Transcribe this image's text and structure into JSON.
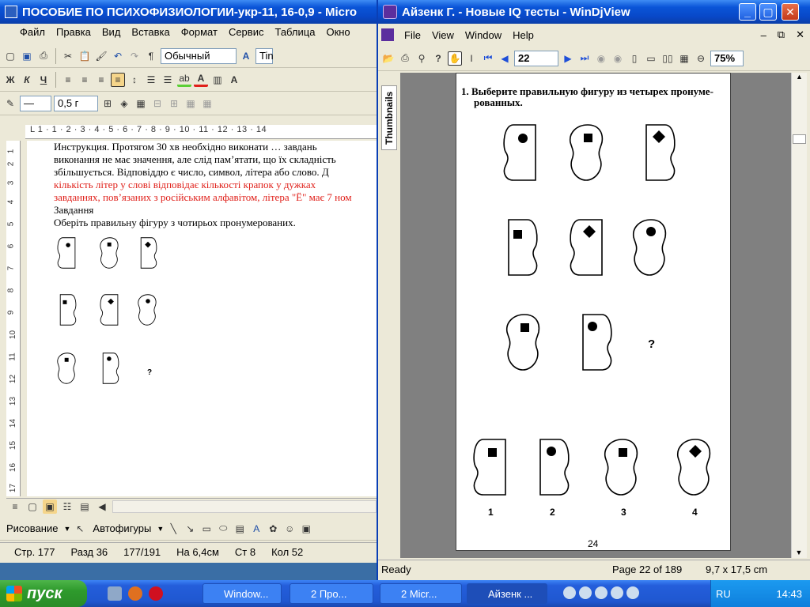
{
  "word": {
    "title": "ПОСОБИЕ ПО ПСИХОФИЗИОЛОГИИ-укр-11, 16-0,9 - Micro",
    "menu": [
      "Файл",
      "Правка",
      "Вид",
      "Вставка",
      "Формат",
      "Сервис",
      "Таблица",
      "Окно"
    ],
    "style_dropdown": "Обычный",
    "font_dropdown": "Tin",
    "line_width": "0,5 г",
    "ruler_marks": "L  1 · 1 · 2 · 3 · 4 · 5 · 6 · 7 · 8 · 9 · 10 · 11 · 12 · 13 · 14",
    "ruler_v_marks": [
      "1",
      "2",
      "3",
      "4",
      "5",
      "6",
      "7",
      "8",
      "9",
      "10",
      "11",
      "12",
      "13",
      "14",
      "15",
      "16",
      "17"
    ],
    "text_line1": "Инструкция. Протягом 30 хв необхідно виконати … завдань",
    "text_line2": "виконання не має значення, але слід пам’ятати, що їх складність",
    "text_line3": "збільшується. Відповіддю є число, символ, літера або слово. Д",
    "text_red1": "кількість літер у слові відповідає кількості крапок у дужках",
    "text_red2": "завданнях, пов’язаних з російським алфавітом, літера \"Ё\" має 7 ном",
    "text_heading": "Завдання",
    "text_task": "Оберіть правильну фігуру з чотирьох пронумерованих.",
    "draw_label": "Рисование",
    "autoshapes_label": "Автофигуры",
    "status": {
      "page": "Стр. 177",
      "section": "Разд 36",
      "pages": "177/191",
      "at": "На 6,4см",
      "line": "Ст 8",
      "col": "Кол 52"
    }
  },
  "djview": {
    "title": "Айзенк Г. - Новые IQ тесты - WinDjView",
    "menu": [
      "File",
      "View",
      "Window",
      "Help"
    ],
    "page_input": "22",
    "zoom": "75%",
    "thumbnails_tab": "Thumbnails",
    "question": "1. Выберите правильную фигуру из четырех пронуме-",
    "question2": "рованных.",
    "question_mark": "?",
    "answers": [
      "1",
      "2",
      "3",
      "4"
    ],
    "page_number": "24",
    "status_ready": "Ready",
    "status_page": "Page 22 of 189",
    "status_size": "9,7 x 17,5 cm"
  },
  "taskbar": {
    "start": "пуск",
    "tasks": [
      "Window...",
      "2 Про...",
      "2 Micr...",
      "Айзенк ..."
    ],
    "lang": "RU",
    "clock": "14:43"
  }
}
